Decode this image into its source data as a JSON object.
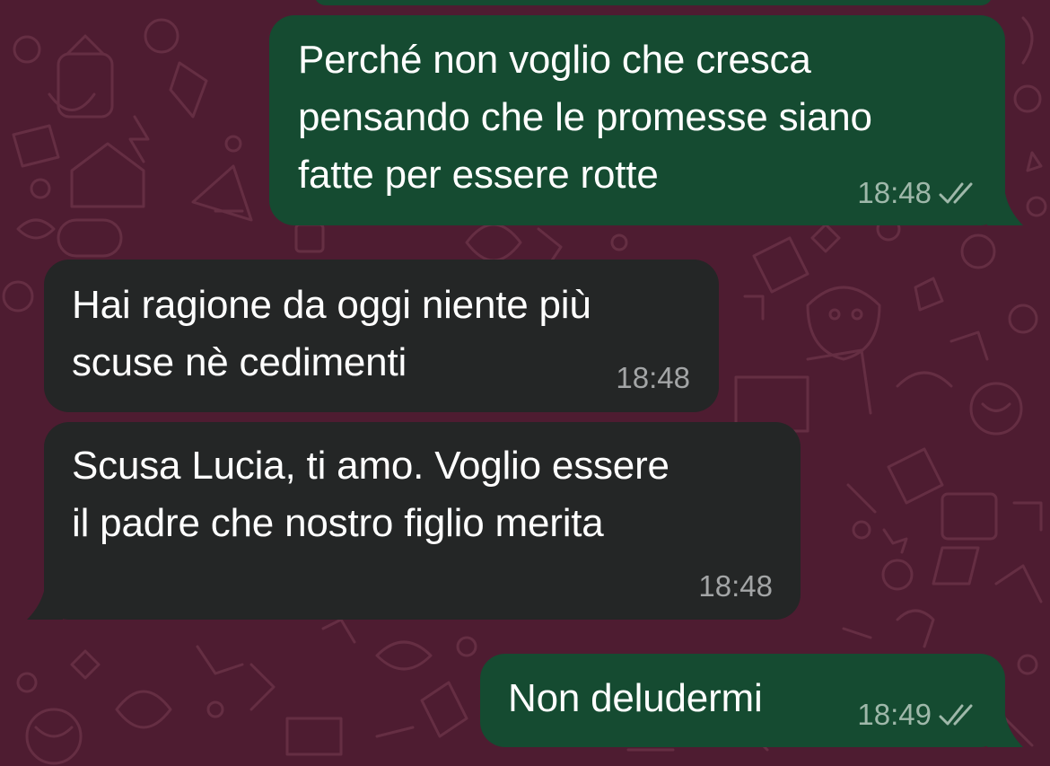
{
  "theme": {
    "background": "#4e1c31",
    "outgoing_bubble": "#154b31",
    "incoming_bubble": "#242626",
    "text": "#ffffff",
    "outgoing_meta": "#9fb8aa",
    "incoming_meta": "#a3a5a6"
  },
  "messages": [
    {
      "direction": "outgoing",
      "lines": [
        "Perché non voglio che cresca",
        "pensando che le promesse siano",
        "fatte per essere rotte"
      ],
      "time": "18:48",
      "status_icon": "double-check-icon"
    },
    {
      "direction": "incoming",
      "lines": [
        "Hai ragione da oggi niente più",
        "scuse nè cedimenti"
      ],
      "time": "18:48"
    },
    {
      "direction": "incoming",
      "lines": [
        "Scusa Lucia, ti amo. Voglio essere",
        "il padre che nostro figlio merita"
      ],
      "time": "18:48"
    },
    {
      "direction": "outgoing",
      "lines": [
        "Non deludermi"
      ],
      "time": "18:49",
      "status_icon": "double-check-icon"
    }
  ]
}
